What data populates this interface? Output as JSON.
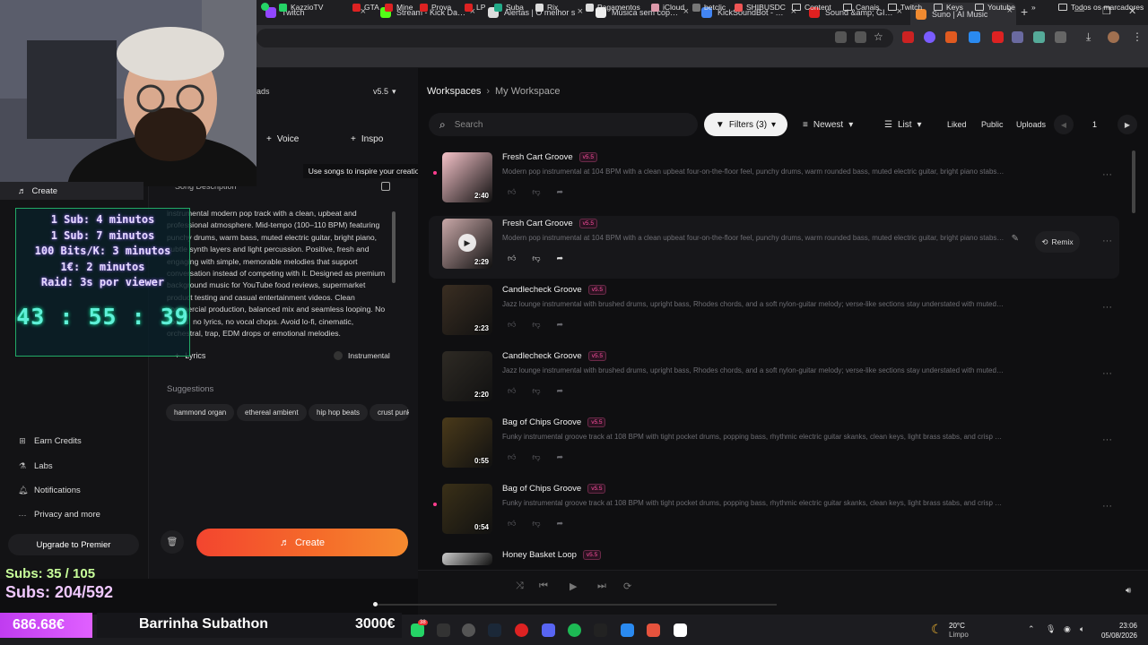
{
  "browser": {
    "tabs": [
      {
        "title": "Twitch",
        "color": "#9146ff"
      },
      {
        "title": "Stream - Kick Dashb",
        "color": "#53fc18"
      },
      {
        "title": "Alertas | O melhor s",
        "color": "#dddddd"
      },
      {
        "title": "Música sem copyrig",
        "color": "#eeeeee"
      },
      {
        "title": "KickSoundBot - Goo",
        "color": "#4285f4"
      },
      {
        "title": "Sound &amp; GIF Al",
        "color": "#e02020"
      },
      {
        "title": "Suno | AI Music",
        "color": "#f08a30"
      }
    ],
    "bookmarks": [
      "KazzioTV",
      "GTA",
      "Mine",
      "Prova",
      "LP",
      "Suba",
      "Rix",
      "Pagamentos",
      "iCloud",
      "betclic",
      "SHIBUSDC",
      "Content",
      "Canais",
      "Twitch",
      "Keys",
      "Youtube"
    ],
    "bookmarks_more": "»",
    "all_bookmarks": "Todos os marcadores"
  },
  "sidebar": {
    "create": "Create",
    "earn": "Earn Credits",
    "labs": "Labs",
    "notifications": "Notifications",
    "privacy": "Privacy and more",
    "upgrade": "Upgrade to Premier",
    "partial_label": "ads"
  },
  "panel": {
    "version": "v5.5",
    "voice": "Voice",
    "inspo": "Inspo",
    "tooltip": "Use songs to inspire your creation",
    "song_description_label": "Song Description",
    "description": "instrumental modern pop track with a clean, upbeat and professional atmosphere. Mid-tempo (100–110 BPM) featuring punchy drums, warm bass, muted electric guitar, bright piano, subtle synth layers and light percussion. Positive, fresh and engaging with simple, memorable melodies that support conversation instead of competing with it. Designed as premium background music for YouTube food reviews, supermarket product testing and casual entertainment videos. Clean commercial production, balanced mix and seamless looping. No vocals, no lyrics, no vocal chops. Avoid lo-fi, cinematic, orchestral, trap, EDM drops or emotional melodies.",
    "lyrics": "Lyrics",
    "instrumental": "Instrumental",
    "suggestions_label": "Suggestions",
    "suggestions": [
      "hammond organ",
      "ethereal ambient",
      "hip hop beats",
      "crust punk"
    ],
    "create_button": "Create"
  },
  "main": {
    "workspaces": "Workspaces",
    "workspace": "My Workspace",
    "search_placeholder": "Search",
    "filters": "Filters (3)",
    "sort": "Newest",
    "view": "List",
    "liked": "Liked",
    "public": "Public",
    "uploads": "Uploads",
    "page": "1",
    "remix": "Remix",
    "songs": [
      {
        "title": "Fresh Cart Groove",
        "version": "v5.5",
        "duration": "2:40",
        "desc": "Modern pop instrumental at 104 BPM with a clean upbeat four-on-the-floor feel, punchy drums, warm rounded bass, muted electric guitar, bright piano stabs, subtle s...",
        "thumb": "#f4c2c8",
        "new": true
      },
      {
        "title": "Fresh Cart Groove",
        "version": "v5.5",
        "duration": "2:29",
        "desc": "Modern pop instrumental at 104 BPM with a clean upbeat four-on-the-floor feel, punchy drums, warm rounded bass, muted electric guitar, bright piano stabs, subtle s...",
        "thumb": "#c9a8a8",
        "new": false
      },
      {
        "title": "Candlecheck Groove",
        "version": "v5.5",
        "duration": "2:23",
        "desc": "Jazz lounge instrumental with brushed drums, upright bass, Rhodes chords, and a soft nylon-guitar melody; verse-like sections stay understated with muted piano tur...",
        "thumb": "#3a2e22",
        "new": false
      },
      {
        "title": "Candlecheck Groove",
        "version": "v5.5",
        "duration": "2:20",
        "desc": "Jazz lounge instrumental with brushed drums, upright bass, Rhodes chords, and a soft nylon-guitar melody; verse-like sections stay understated with muted piano tur...",
        "thumb": "#2e2a24",
        "new": false
      },
      {
        "title": "Bag of Chips Groove",
        "version": "v5.5",
        "duration": "0:55",
        "desc": "Funky instrumental groove track at 108 BPM with tight pocket drums, popping bass, rhythmic electric guitar skanks, clean keys, light brass stabs, and crisp hand percu...",
        "thumb": "#4a3a1a",
        "new": false
      },
      {
        "title": "Bag of Chips Groove",
        "version": "v5.5",
        "duration": "0:54",
        "desc": "Funky instrumental groove track at 108 BPM with tight pocket drums, popping bass, rhythmic electric guitar skanks, clean keys, light brass stabs, and crisp hand percu...",
        "thumb": "#3a3018",
        "new": true
      },
      {
        "title": "Honey Basket Loop",
        "version": "v5.5",
        "duration": "",
        "desc": "",
        "thumb": "#cccccc",
        "new": false
      }
    ]
  },
  "overlay": {
    "timer_rules": [
      "1 Sub: 4 minutos",
      "1 Sub: 7 minutos",
      "100 Bits/K: 3 minutos",
      "1€: 2 minutos",
      "Raid: 3s por viewer"
    ],
    "timer": "43 : 55 : 39",
    "subs_line1": "Subs: 35 / 105",
    "subs_line2": "Subs: 204/592",
    "money": "686.68€",
    "subathon": "Barrinha Subathon",
    "goal": "3000€",
    "money_progress": 0.2289
  },
  "taskbar": {
    "weather_temp": "20°C",
    "weather_desc": "Limpo",
    "time": "23:06",
    "date": "05/08/2026",
    "badge": "38"
  },
  "colors": {
    "accent": "#f3452f",
    "version_pink": "#ff4fa0",
    "timer_cyan": "#5ff0d8",
    "money_purple": "#c03cf0"
  }
}
